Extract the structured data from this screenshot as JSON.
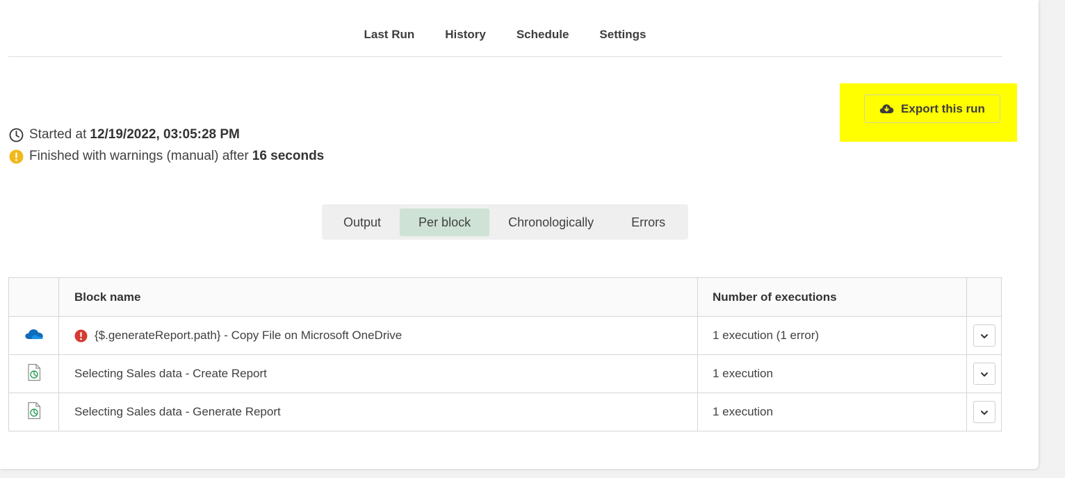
{
  "top_tabs": [
    "Last Run",
    "History",
    "Schedule",
    "Settings"
  ],
  "export_button": {
    "label": "Export this run",
    "icon": "cloud-download-icon"
  },
  "run": {
    "started_prefix": "Started at",
    "started_value": "12/19/2022, 03:05:28 PM",
    "finished_prefix": "Finished with warnings (manual) after",
    "finished_value": "16 seconds"
  },
  "segments": {
    "output": "Output",
    "per_block": "Per block",
    "chronologically": "Chronologically",
    "errors": "Errors",
    "selected": "Per block"
  },
  "table": {
    "headers": {
      "block_name": "Block name",
      "executions": "Number of executions"
    },
    "rows": [
      {
        "icon": "onedrive-cloud-icon",
        "has_error": true,
        "name": "{$.generateReport.path} - Copy File on Microsoft OneDrive",
        "executions": "1 execution (1 error)"
      },
      {
        "icon": "report-document-icon",
        "has_error": false,
        "name": "Selecting Sales data - Create Report",
        "executions": "1 execution"
      },
      {
        "icon": "report-document-icon",
        "has_error": false,
        "name": "Selecting Sales data - Generate Report",
        "executions": "1 execution"
      }
    ]
  },
  "colors": {
    "highlight": "#ffff00",
    "active_segment": "#cfe2d6",
    "warning": "#f2b91c",
    "error": "#d63b32",
    "onedrive": "#0f6cbd"
  }
}
